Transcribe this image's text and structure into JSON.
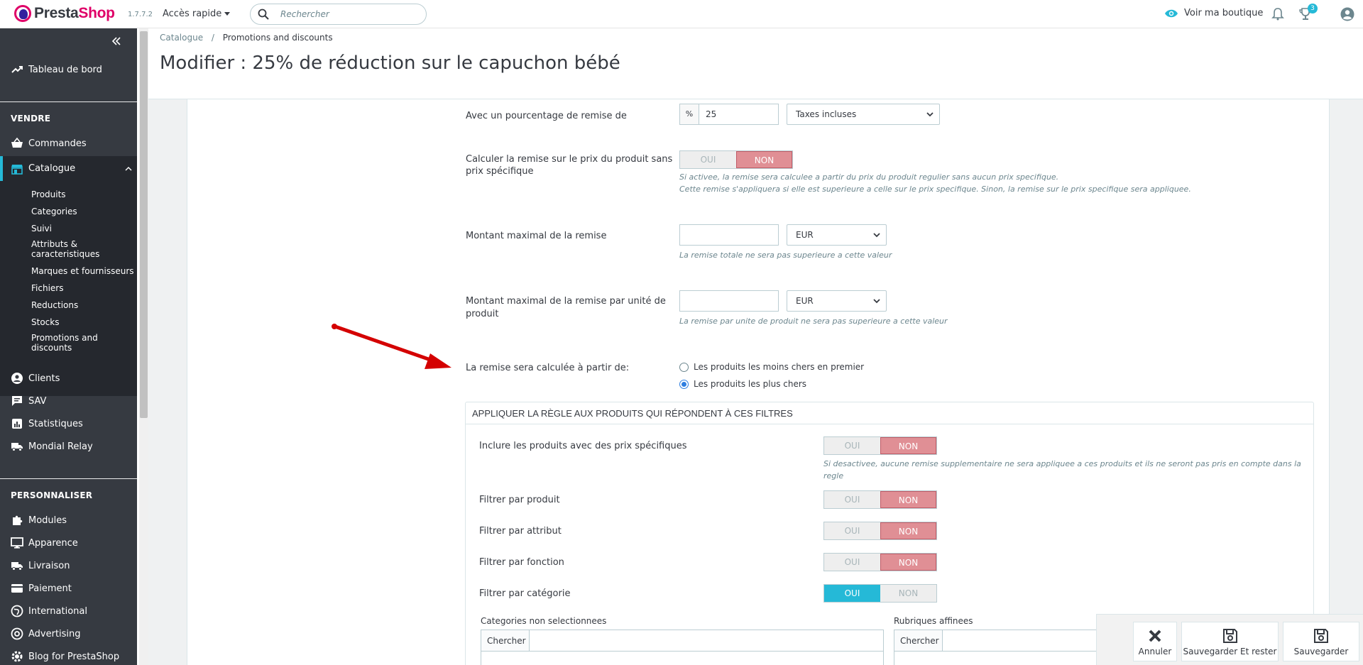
{
  "header": {
    "brand_part1": "Presta",
    "brand_part2": "Shop",
    "version": "1.7.7.2",
    "quick_access": "Accès rapide",
    "search_placeholder": "Rechercher",
    "view_shop": "Voir ma boutique",
    "notif_badge": "3"
  },
  "sidebar": {
    "dashboard": "Tableau de bord",
    "section_sell": "VENDRE",
    "orders": "Commandes",
    "catalog": "Catalogue",
    "catalog_items": [
      "Produits",
      "Categories",
      "Suivi",
      "Attributs & caracteristiques",
      "Marques et fournisseurs",
      "Fichiers",
      "Reductions",
      "Stocks",
      "Promotions and discounts"
    ],
    "customers": "Clients",
    "sav": "SAV",
    "stats": "Statistiques",
    "mondial": "Mondial Relay",
    "section_custom": "PERSONNALISER",
    "modules": "Modules",
    "appearance": "Apparence",
    "shipping": "Livraison",
    "payment": "Paiement",
    "international": "International",
    "advertising": "Advertising",
    "blog": "Blog for PrestaShop"
  },
  "page": {
    "breadcrumb_parent": "Catalogue",
    "breadcrumb_sep": "/",
    "breadcrumb_current": "Promotions and discounts",
    "title": "Modifier : 25% de réduction sur le capuchon bébé"
  },
  "form": {
    "percent_label": "Avec un pourcentage de remise de",
    "percent_addon": "%",
    "percent_value": "25",
    "tax_select": "Taxes incluses",
    "calc_label_1": "Calculer la remise sur le prix du produit sans",
    "calc_label_2": "prix spécifique",
    "yes": "OUI",
    "no": "NON",
    "calc_help_1": "Si activee, la remise sera calculee a partir du prix du produit regulier sans aucun prix specifique.",
    "calc_help_2": "Cette remise s'appliquera si elle est superieure a celle sur le prix specifique. Sinon, la remise sur le prix specifique sera appliquee.",
    "max_label": "Montant maximal de la remise",
    "currency": "EUR",
    "max_help": "La remise totale ne sera pas superieure a cette valeur",
    "max_unit_label_1": "Montant maximal de la remise par unité de",
    "max_unit_label_2": "produit",
    "max_unit_help": "La remise par unite de produit ne sera pas superieure a cette valeur",
    "based_on_label": "La remise sera calculée à partir de:",
    "radio_cheapest": "Les produits les moins chers en premier",
    "radio_expensive": "Les produits les plus chers"
  },
  "filters": {
    "title": "Appliquer la règle aux produits qui répondent à ces filtres",
    "include_specific": "Inclure les produits avec des prix spécifiques",
    "include_help": "Si desactivee, aucune remise supplementaire ne sera appliquee a ces produits et ils ne seront pas pris en compte dans la regle",
    "by_product": "Filtrer par produit",
    "by_attribute": "Filtrer par attribut",
    "by_feature": "Filtrer par fonction",
    "by_category": "Filtrer par catégorie",
    "unselected_title": "Categories non selectionnees",
    "selected_title": "Rubriques affinees",
    "search_label": "Chercher"
  },
  "footer": {
    "cancel": "Annuler",
    "save_stay": "Sauvegarder Et rester",
    "save": "Sauvegarder"
  },
  "colors": {
    "accent": "#25b9d7",
    "brand": "#df0067",
    "sidebar": "#363a41",
    "toggle_no": "#e08f95",
    "arrow": "#d40000"
  }
}
